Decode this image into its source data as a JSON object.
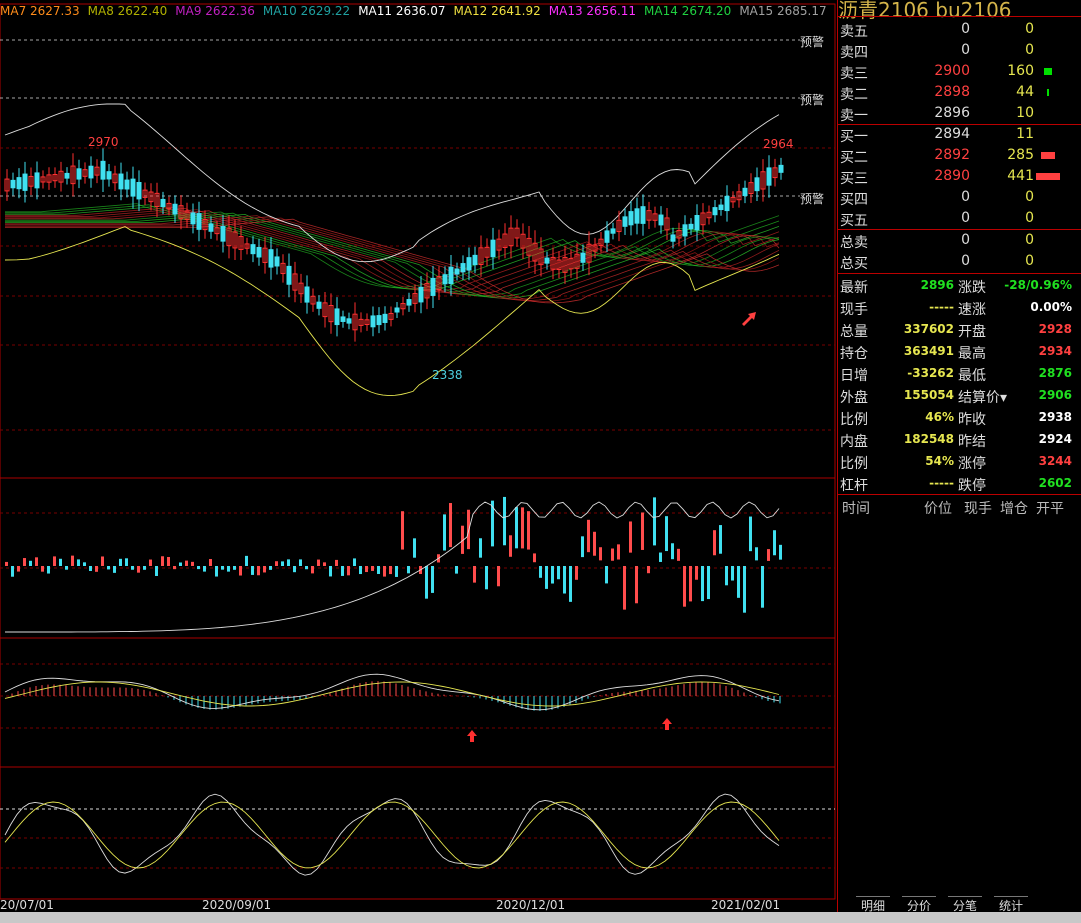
{
  "ma_legend": [
    {
      "label": "MA7 2627.33",
      "color": "#ff8c1a"
    },
    {
      "label": "MA8 2622.40",
      "color": "#b0b000"
    },
    {
      "label": "MA9 2622.36",
      "color": "#c020c0"
    },
    {
      "label": "MA10 2629.22",
      "color": "#20a0a0"
    },
    {
      "label": "MA11 2636.07",
      "color": "#ffffff"
    },
    {
      "label": "MA12 2641.92",
      "color": "#f0e040"
    },
    {
      "label": "MA13 2656.11",
      "color": "#ff30ff"
    },
    {
      "label": "MA14 2674.20",
      "color": "#20d040"
    },
    {
      "label": "MA15 2685.17",
      "color": "#a0a0a0"
    }
  ],
  "warnings": [
    "预警",
    "预警",
    "预警"
  ],
  "price_high_left": "2970",
  "price_high_right": "2964",
  "price_low": "2338",
  "dates": [
    "20/07/01",
    "2020/09/01",
    "2020/12/01",
    "2021/02/01"
  ],
  "quote": {
    "title": "沥青2106   bu2106",
    "sell": [
      {
        "label": "卖五",
        "price": "0",
        "vol": "0",
        "price_color": "#ddd"
      },
      {
        "label": "卖四",
        "price": "0",
        "vol": "0",
        "price_color": "#ddd"
      },
      {
        "label": "卖三",
        "price": "2900",
        "vol": "160",
        "price_color": "#ff4040",
        "bar_color": "#00e000",
        "bar_w": 8
      },
      {
        "label": "卖二",
        "price": "2898",
        "vol": "44",
        "price_color": "#ff4040",
        "bar_color": "#00e000",
        "bar_w": 2
      },
      {
        "label": "卖一",
        "price": "2896",
        "vol": "10",
        "price_color": "#ddd"
      }
    ],
    "buy": [
      {
        "label": "买一",
        "price": "2894",
        "vol": "11",
        "price_color": "#ddd"
      },
      {
        "label": "买二",
        "price": "2892",
        "vol": "285",
        "price_color": "#ff4040",
        "bar_color": "#ff4040",
        "bar_w": 14
      },
      {
        "label": "买三",
        "price": "2890",
        "vol": "441",
        "price_color": "#ff4040",
        "bar_color": "#ff4040",
        "bar_w": 24
      },
      {
        "label": "买四",
        "price": "0",
        "vol": "0",
        "price_color": "#ddd"
      },
      {
        "label": "买五",
        "price": "0",
        "vol": "0",
        "price_color": "#ddd"
      }
    ],
    "totals": [
      {
        "label": "总卖",
        "price": "0",
        "vol": "0"
      },
      {
        "label": "总买",
        "price": "0",
        "vol": "0"
      }
    ],
    "stats_left": [
      {
        "label": "最新",
        "value": "2896",
        "color": "#20e020"
      },
      {
        "label": "现手",
        "value": "-----",
        "color": "#e6e650"
      },
      {
        "label": "总量",
        "value": "337602",
        "color": "#e6e650"
      },
      {
        "label": "持仓",
        "value": "363491",
        "color": "#e6e650"
      },
      {
        "label": "日增",
        "value": "-33262",
        "color": "#e6e650"
      },
      {
        "label": "外盘",
        "value": "155054",
        "color": "#e6e650"
      },
      {
        "label": "比例",
        "value": "46%",
        "color": "#e6e650"
      },
      {
        "label": "内盘",
        "value": "182548",
        "color": "#e6e650"
      },
      {
        "label": "比例",
        "value": "54%",
        "color": "#e6e650"
      },
      {
        "label": "杠杆",
        "value": "-----",
        "color": "#e6e650"
      }
    ],
    "stats_right": [
      {
        "label": "涨跌",
        "value": "-28/0.96%",
        "color": "#20e020"
      },
      {
        "label": "速涨",
        "value": "0.00%",
        "color": "#ffffff"
      },
      {
        "label": "开盘",
        "value": "2928",
        "color": "#ff4040"
      },
      {
        "label": "最高",
        "value": "2934",
        "color": "#ff4040"
      },
      {
        "label": "最低",
        "value": "2876",
        "color": "#20e020"
      },
      {
        "label": "结算价▾",
        "value": "2906",
        "color": "#20e020"
      },
      {
        "label": "昨收",
        "value": "2938",
        "color": "#ffffff"
      },
      {
        "label": "昨结",
        "value": "2924",
        "color": "#ffffff"
      },
      {
        "label": "涨停",
        "value": "3244",
        "color": "#ff4040"
      },
      {
        "label": "跌停",
        "value": "2602",
        "color": "#20e020"
      }
    ],
    "detail_headers": [
      "时间",
      "价位",
      "现手",
      "增仓",
      "开平"
    ],
    "tabs": [
      "明细",
      "分价",
      "分笔",
      "统计"
    ]
  }
}
